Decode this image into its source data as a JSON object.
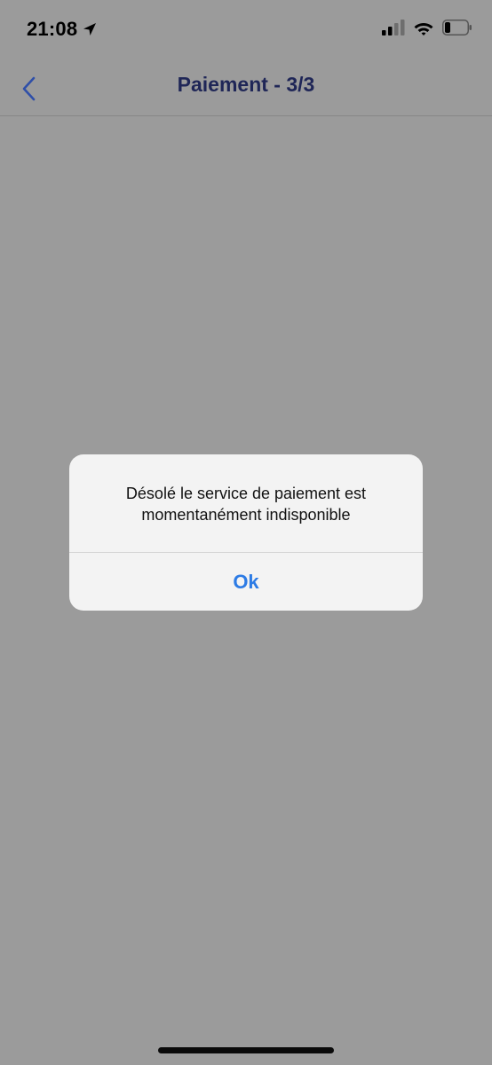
{
  "status_bar": {
    "time": "21:08",
    "location_icon": "location-arrow-icon",
    "signal_icon": "cellular-signal-icon",
    "wifi_icon": "wifi-icon",
    "battery_icon": "battery-icon",
    "battery_level": 0.25
  },
  "nav": {
    "back_icon": "chevron-left-icon",
    "title": "Paiement - 3/3",
    "title_color": "#1f2657",
    "accent_color": "#2f4fa8"
  },
  "alert": {
    "message_line1": "Désolé le service de paiement est",
    "message_line2": "momentanément indisponible",
    "button_label": "Ok",
    "button_color": "#2c7be5"
  },
  "colors": {
    "overlay_background": "#9b9b9b",
    "alert_background": "#f3f3f3"
  }
}
